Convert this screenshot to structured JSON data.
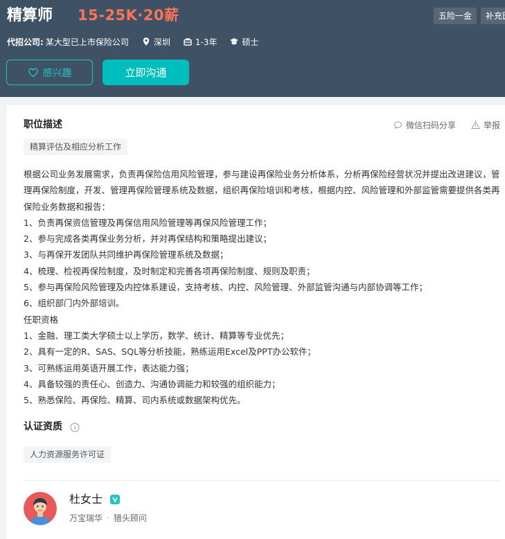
{
  "job": {
    "title": "精算师",
    "salary": "15-25K·20薪",
    "tags": [
      "五险一金",
      "补充医"
    ],
    "company_label": "代招公司:",
    "company": "某大型已上市保险公司",
    "city": "深圳",
    "experience": "1-3年",
    "education": "硕士"
  },
  "actions": {
    "interest_label": "感兴趣",
    "chat_label": "立即沟通"
  },
  "description": {
    "title": "职位描述",
    "share_label": "微信扫码分享",
    "report_label": "举报",
    "keyword": "精算评估及相应分析工作",
    "lines": [
      "根据公司业务发展需求，负责再保险信用风险管理，参与建设再保险业务分析体系，分析再保险经营状况并提出改进建议，管理再保险制度，开发、管理再保险管理系统及数据，组织再保险培训和考核，根据内控、风险管理和外部监管需要提供各类再保险业务数据和报告：",
      "1、负责再保资信管理及再保信用风险管理等再保风险管理工作；",
      "2、参与完成各类再保业务分析，并对再保结构和策略提出建议；",
      "3、与再保开发团队共同维护再保险管理系统及数据；",
      "4、梳理、检视再保险制度，及时制定和完善各项再保险制度、规则及职责；",
      "5、参与再保险风险管理及内控体系建设，支持考核、内控、风险管理、外部监管沟通与内部协调等工作；",
      "6、组织部门内外部培训。",
      "任职资格",
      "1、金融、理工类大学硕士以上学历，数学、统计、精算等专业优先；",
      "2、具有一定的R、SAS、SQL等分析技能，熟练运用Excel及PPT办公软件；",
      "3、可熟练运用英语开展工作，表达能力强；",
      "4、具备较强的责任心、创造力、沟通协调能力和较强的组织能力；",
      "5、熟悉保险、再保险、精算、司内系统或数据架构优先。"
    ]
  },
  "certification": {
    "title": "认证资质",
    "item": "人力资源服务许可证"
  },
  "recruiter": {
    "name": "杜女士",
    "company": "万宝瑞华",
    "role": "猎头顾问"
  },
  "colors": {
    "header_bg": "#3f5164",
    "salary": "#ff7357",
    "accent": "#00bebd"
  }
}
